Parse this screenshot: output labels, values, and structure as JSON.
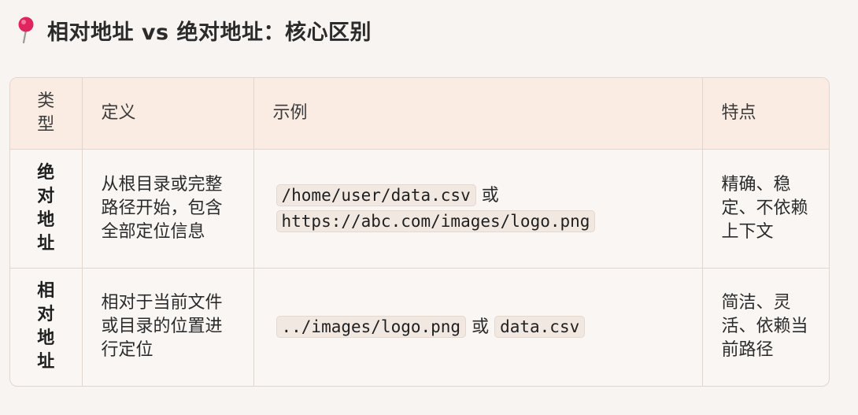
{
  "heading": {
    "icon": "pushpin-icon",
    "title": "相对地址 vs 绝对地址：核心区别"
  },
  "colors": {
    "background": "#f7f4f1",
    "header_row": "#fbece3",
    "border": "#e3d5cb",
    "code_bg": "#f1e8e2",
    "pin": "#e0245e"
  },
  "table": {
    "headers": {
      "type": "类型",
      "definition": "定义",
      "example": "示例",
      "feature": "特点"
    },
    "rows": [
      {
        "type": "绝对地址",
        "definition": "从根目录或完整路径开始，包含全部定位信息",
        "example_code_1": "/home/user/data.csv",
        "example_or": "或",
        "example_code_2": "https://abc.com/images/logo.png",
        "feature": "精确、稳定、不依赖上下文"
      },
      {
        "type": "相对地址",
        "definition": "相对于当前文件或目录的位置进行定位",
        "example_code_1": "../images/logo.png",
        "example_or": "或",
        "example_code_2": "data.csv",
        "feature": "简洁、灵活、依赖当前路径"
      }
    ]
  }
}
